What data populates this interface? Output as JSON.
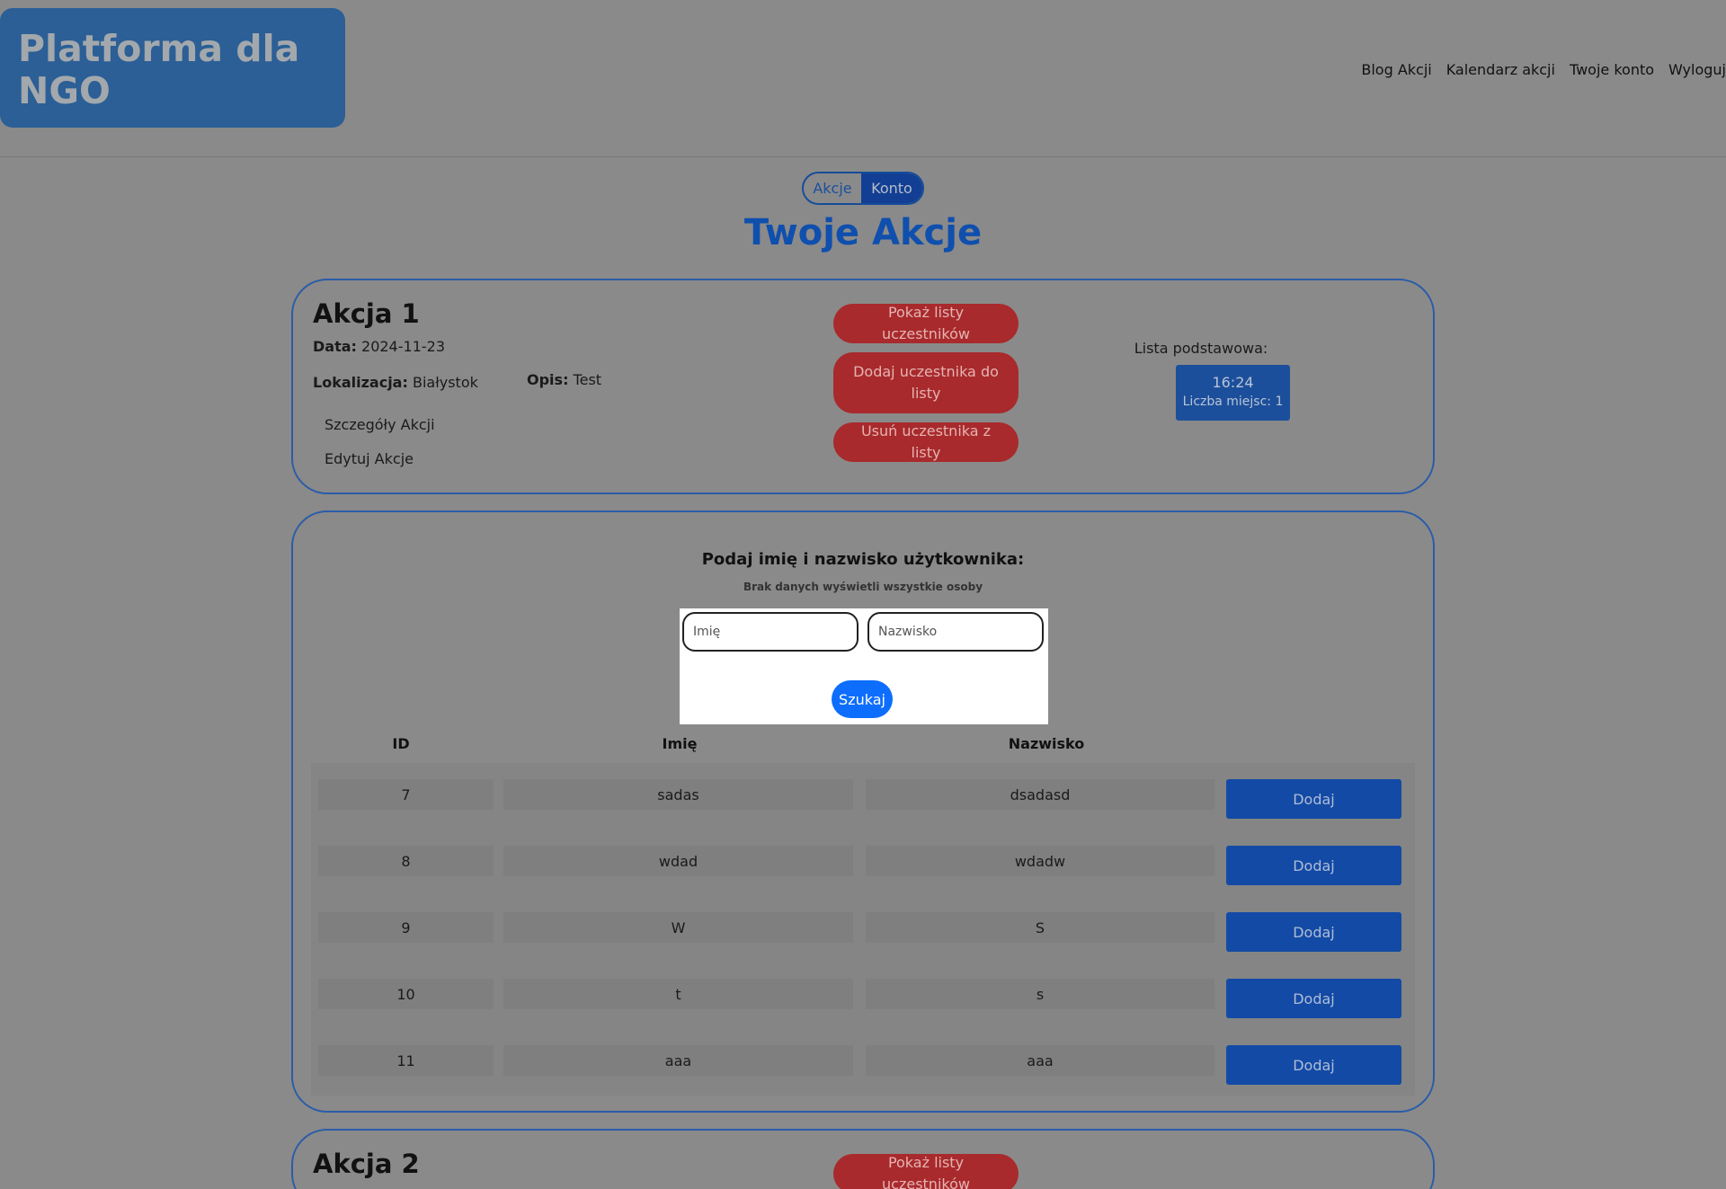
{
  "header": {
    "logo": "Platforma dla NGO",
    "nav": [
      "Blog Akcji",
      "Kalendarz akcji",
      "Twoje konto",
      "Wyloguj"
    ]
  },
  "toggle": {
    "left": "Akcje",
    "right": "Konto"
  },
  "page_title": "Twoje Akcje",
  "akcja1": {
    "title": "Akcja 1",
    "data_label": "Data:",
    "data_value": "2024-11-23",
    "lokalizacja_label": "Lokalizacja:",
    "lokalizacja_value": "Białystok",
    "opis_label": "Opis:",
    "opis_value": "Test",
    "link_szczegoly": "Szczegóły Akcji",
    "link_edytuj": "Edytuj Akcje",
    "btn_pokaz": "Pokaż listy uczestników",
    "btn_dodaj": "Dodaj uczestnika do listy",
    "btn_usun": "Usuń uczestnika z listy",
    "lista_label": "Lista podstawowa:",
    "slot_time": "16:24",
    "slot_places": "Liczba miejsc: 1"
  },
  "search": {
    "title": "Podaj imię i nazwisko użytkownika:",
    "subtitle": "Brak danych wyświetli wszystkie osoby",
    "imie_placeholder": "Imię",
    "nazwisko_placeholder": "Nazwisko",
    "button": "Szukaj"
  },
  "table": {
    "headers": {
      "id": "ID",
      "imie": "Imię",
      "nazwisko": "Nazwisko"
    },
    "action_label": "Dodaj",
    "rows": [
      {
        "id": "7",
        "imie": "sadas",
        "nazwisko": "dsadasd"
      },
      {
        "id": "8",
        "imie": "wdad",
        "nazwisko": "wdadw"
      },
      {
        "id": "9",
        "imie": "W",
        "nazwisko": "S"
      },
      {
        "id": "10",
        "imie": "t",
        "nazwisko": "s"
      },
      {
        "id": "11",
        "imie": "aaa",
        "nazwisko": "aaa"
      }
    ]
  },
  "akcja2": {
    "title": "Akcja 2",
    "btn_pokaz": "Pokaż listy uczestników"
  }
}
